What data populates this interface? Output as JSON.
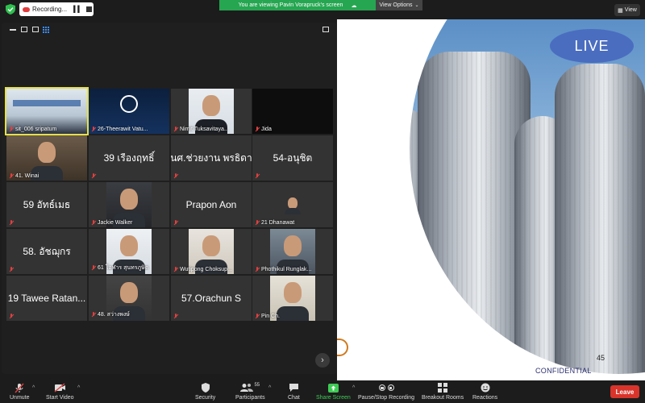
{
  "recording": {
    "label": "Recording..."
  },
  "banner": {
    "text": "You are viewing Pavin Vorapruck's screen",
    "view_options": "View Options"
  },
  "view_button": {
    "label": "View"
  },
  "shared": {
    "live": "LIVE",
    "page_number": "45",
    "confidential": "CONFIDENTIAL"
  },
  "tiles": [
    {
      "name": "sit_006 sripatum",
      "kind": "video"
    },
    {
      "name": "26-Theerawit Vatu...",
      "kind": "video"
    },
    {
      "name": "Nimit Tuksavitaya...",
      "kind": "video"
    },
    {
      "name": "Jida",
      "kind": "black"
    },
    {
      "name": "41. Winai",
      "kind": "video"
    },
    {
      "name": "39 เรืองฤทธิ์",
      "kind": "text"
    },
    {
      "name": "นศ.ช่วยงาน พรธิดา",
      "kind": "text"
    },
    {
      "name": "54-อนุชิต",
      "kind": "text"
    },
    {
      "name": "59 อัทธ์เมธ",
      "kind": "text"
    },
    {
      "name": "Jackie Walker",
      "kind": "video"
    },
    {
      "name": "Prapon Aon",
      "kind": "text"
    },
    {
      "name": "21 Dhanawat",
      "kind": "video"
    },
    {
      "name": "58. อัชฌุกร",
      "kind": "text"
    },
    {
      "name": "61 โอฬาร สุนทรภูษิต",
      "kind": "video"
    },
    {
      "name": "Wutipong Choksup...",
      "kind": "video"
    },
    {
      "name": "Phothikul Runglak...",
      "kind": "video"
    },
    {
      "name": "19 Tawee Ratan...",
      "kind": "text"
    },
    {
      "name": "48. สว่างพงษ์",
      "kind": "video"
    },
    {
      "name": "57.Orachun S",
      "kind": "text"
    },
    {
      "name": "Pin Ch.",
      "kind": "video"
    }
  ],
  "toolbar": {
    "unmute": "Unmute",
    "start_video": "Start Video",
    "security": "Security",
    "participants": "Participants",
    "participant_count": "55",
    "chat": "Chat",
    "share_screen": "Share Screen",
    "recording": "Pause/Stop Recording",
    "breakout": "Breakout Rooms",
    "reactions": "Reactions",
    "leave": "Leave"
  },
  "colors": {
    "accent_green": "#26a651",
    "leave_red": "#d9342b",
    "live_blue": "#4a6dc0"
  }
}
